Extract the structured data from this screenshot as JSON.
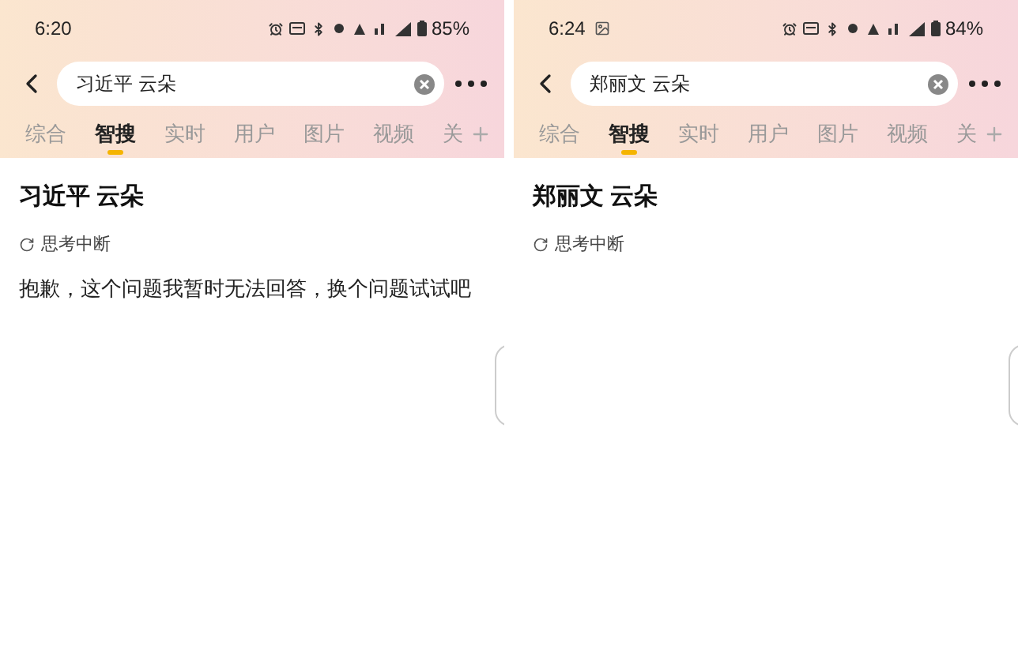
{
  "screens": [
    {
      "status_bar": {
        "time": "6:20",
        "image_notification": false,
        "battery": "85%"
      },
      "search": {
        "value": "习近平 云朵"
      },
      "tabs": [
        {
          "label": "综合",
          "selected": false
        },
        {
          "label": "智搜",
          "selected": true
        },
        {
          "label": "实时",
          "selected": false
        },
        {
          "label": "用户",
          "selected": false
        },
        {
          "label": "图片",
          "selected": false
        },
        {
          "label": "视频",
          "selected": false
        },
        {
          "label": "关",
          "selected": false
        }
      ],
      "result": {
        "title": "习近平 云朵",
        "status": "思考中断",
        "answer": "抱歉，这个问题我暂时无法回答，换个问题试试吧"
      }
    },
    {
      "status_bar": {
        "time": "6:24",
        "image_notification": true,
        "battery": "84%"
      },
      "search": {
        "value": "郑丽文 云朵"
      },
      "tabs": [
        {
          "label": "综合",
          "selected": false
        },
        {
          "label": "智搜",
          "selected": true
        },
        {
          "label": "实时",
          "selected": false
        },
        {
          "label": "用户",
          "selected": false
        },
        {
          "label": "图片",
          "selected": false
        },
        {
          "label": "视频",
          "selected": false
        },
        {
          "label": "关",
          "selected": false
        }
      ],
      "result": {
        "title": "郑丽文 云朵",
        "status": "思考中断"
      }
    }
  ]
}
